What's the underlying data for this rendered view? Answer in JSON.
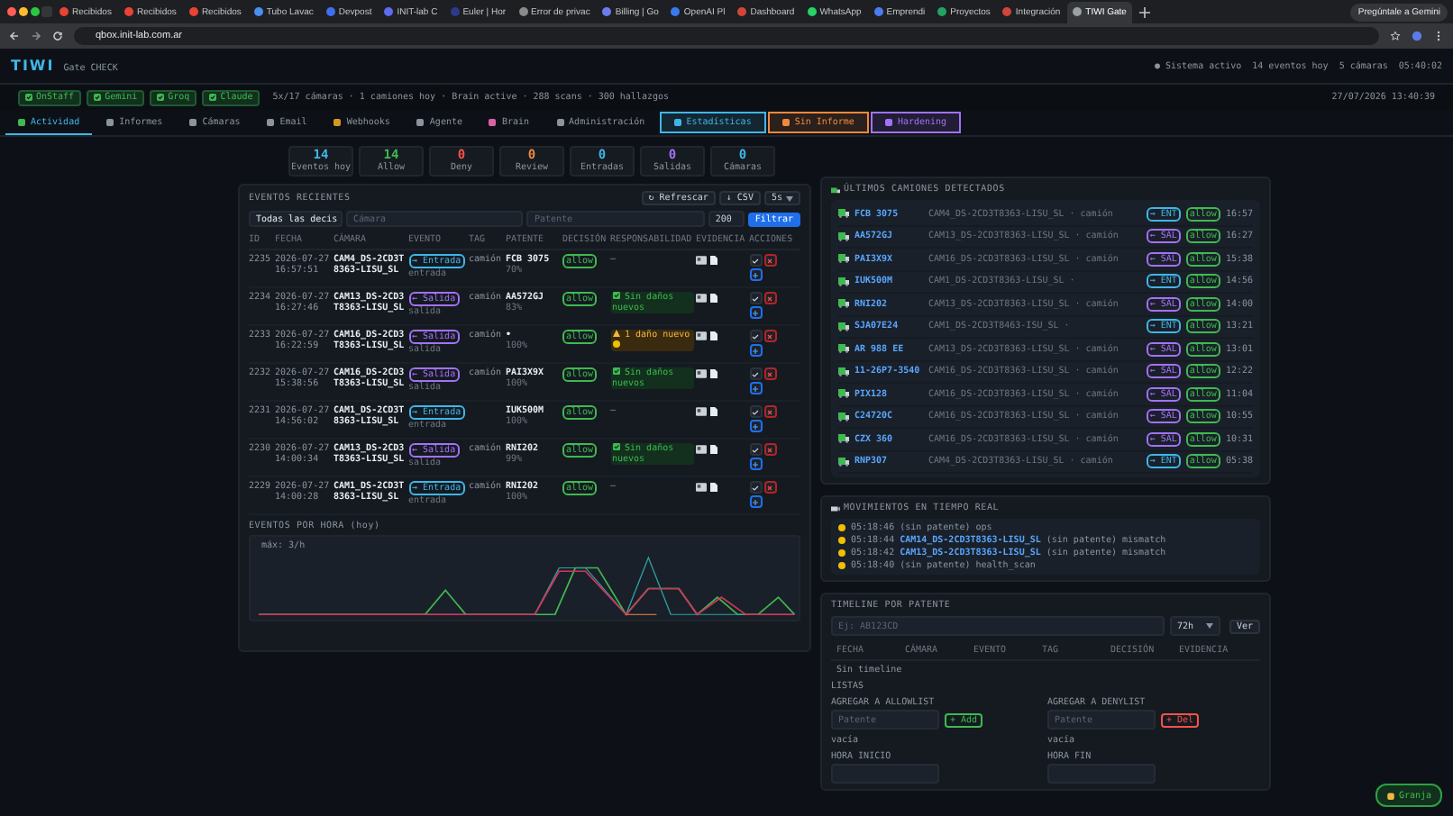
{
  "browser": {
    "tabs": [
      {
        "label": "Recibidos",
        "color": "#ea4335",
        "selected": false
      },
      {
        "label": "Recibidos",
        "color": "#ea4335",
        "selected": false
      },
      {
        "label": "Recibidos",
        "color": "#ea4335",
        "selected": false
      },
      {
        "label": "Tubo Lavac",
        "color": "#4a8ff0",
        "selected": false
      },
      {
        "label": "Devpost",
        "color": "#3d6ff0",
        "selected": false
      },
      {
        "label": "INIT-lab C",
        "color": "#5b6cf0",
        "selected": false
      },
      {
        "label": "Euler | Hor",
        "color": "#2b3a8a",
        "selected": false
      },
      {
        "label": "Error de privac",
        "color": "#8a8a8a",
        "selected": false
      },
      {
        "label": "Billing | Go",
        "color": "#6e7bf0",
        "selected": false
      },
      {
        "label": "OpenAI Pl",
        "color": "#3a7af0",
        "selected": false
      },
      {
        "label": "Dashboard",
        "color": "#d2453b",
        "selected": false
      },
      {
        "label": "WhatsApp",
        "color": "#25d366",
        "selected": false
      },
      {
        "label": "Emprendi",
        "color": "#4a7cf0",
        "selected": false
      },
      {
        "label": "Proyectos",
        "color": "#1fa463",
        "selected": false
      },
      {
        "label": "Integración",
        "color": "#d2453b",
        "selected": false
      },
      {
        "label": "TIWI Gate",
        "color": "#9aa0a6",
        "selected": true
      }
    ],
    "gemini": "Pregúntale a Gemini",
    "url": "qbox.init-lab.com.ar"
  },
  "header": {
    "logo": "TIWI",
    "subtitle": "Gate CHECK",
    "status": [
      "● Sistema activo",
      "14 eventos hoy",
      "5 cámaras",
      "05:40:02"
    ]
  },
  "services": [
    {
      "label": "OnStaff",
      "checked": true
    },
    {
      "label": "Gemini",
      "checked": true
    },
    {
      "label": "Groq",
      "checked": true
    },
    {
      "label": "Claude",
      "checked": true
    }
  ],
  "summary": "5x/17 cámaras · 1 camiones hoy · Brain active · 288 scans · 300 hallazgos",
  "timestamp": "27/07/2026 13:40:39",
  "nav": [
    {
      "label": "Actividad",
      "selected": true,
      "color": "#3fb950"
    },
    {
      "label": "Informes",
      "selected": false,
      "color": "#8b949e"
    },
    {
      "label": "Cámaras",
      "selected": false,
      "color": "#8b949e"
    },
    {
      "label": "Email",
      "selected": false,
      "color": "#8b949e"
    },
    {
      "label": "Webhooks",
      "selected": false,
      "color": "#d29922"
    },
    {
      "label": "Agente",
      "selected": false,
      "color": "#8b949e"
    },
    {
      "label": "Brain",
      "selected": false,
      "color": "#db61a2"
    },
    {
      "label": "Administración",
      "selected": false,
      "color": "#8b949e"
    },
    {
      "label": "Estadísticas",
      "selected": false,
      "kind": "boxed",
      "color": "#3fb6e8"
    },
    {
      "label": "Sin Informe",
      "selected": false,
      "kind": "boxed",
      "color": "#f0883e"
    },
    {
      "label": "Hardening",
      "selected": false,
      "kind": "boxed",
      "color": "#a371f7"
    }
  ],
  "stats": [
    {
      "value": "14",
      "label": "Eventos hoy",
      "color": "#3fb6e8"
    },
    {
      "value": "14",
      "label": "Allow",
      "color": "#3fb950"
    },
    {
      "value": "0",
      "label": "Deny",
      "color": "#f85149"
    },
    {
      "value": "0",
      "label": "Review",
      "color": "#f0883e"
    },
    {
      "value": "0",
      "label": "Entradas",
      "color": "#3fb6e8"
    },
    {
      "value": "0",
      "label": "Salidas",
      "color": "#a371f7"
    },
    {
      "value": "0",
      "label": "Cámaras",
      "color": "#3fb6e8"
    }
  ],
  "events": {
    "title": "EVENTOS RECIENTES",
    "refresh": "↻ Refrescar",
    "csv": "↓ CSV",
    "interval": "5s",
    "filter_decision": "Todas las decis",
    "camera_placeholder": "Cámara",
    "plate_placeholder": "Patente",
    "limit": "200",
    "filter_button": "Filtrar",
    "columns": [
      "ID",
      "FECHA",
      "CÁMARA",
      "EVENTO",
      "TAG",
      "PATENTE",
      "DECISIÓN",
      "RESPONSABILIDAD",
      "EVIDENCIA",
      "ACCIONES"
    ],
    "rows": [
      {
        "id": "2235",
        "date": "2026-07-27 16:57:51",
        "camera": "CAM4_DS-2CD3T8363-LISU_SL",
        "event": {
          "label": "→ Entrada",
          "sub": "entrada",
          "kind": "in"
        },
        "tag": "camión",
        "plate": "FCB 3075",
        "conf": "70%",
        "decision": "allow",
        "resp": {
          "kind": "none",
          "text": "—"
        }
      },
      {
        "id": "2234",
        "date": "2026-07-27 16:27:46",
        "camera": "CAM13_DS-2CD3T8363-LISU_SL",
        "event": {
          "label": "← Salida",
          "sub": "salida",
          "kind": "out"
        },
        "tag": "camión",
        "plate": "AA572GJ",
        "conf": "83%",
        "decision": "allow",
        "resp": {
          "kind": "ok",
          "text": "Sin daños nuevos"
        }
      },
      {
        "id": "2233",
        "date": "2026-07-27 16:22:59",
        "camera": "CAM16_DS-2CD3T8363-LISU_SL",
        "event": {
          "label": "← Salida",
          "sub": "salida",
          "kind": "out"
        },
        "tag": "camión",
        "plate": "•",
        "conf": "100%",
        "decision": "allow",
        "resp": {
          "kind": "warn",
          "text": "1 daño nuevo"
        }
      },
      {
        "id": "2232",
        "date": "2026-07-27 15:38:56",
        "camera": "CAM16_DS-2CD3T8363-LISU_SL",
        "event": {
          "label": "← Salida",
          "sub": "salida",
          "kind": "out"
        },
        "tag": "camión",
        "plate": "PAI3X9X",
        "conf": "100%",
        "decision": "allow",
        "resp": {
          "kind": "ok",
          "text": "Sin daños nuevos"
        }
      },
      {
        "id": "2231",
        "date": "2026-07-27 14:56:02",
        "camera": "CAM1_DS-2CD3T8363-LISU_SL",
        "event": {
          "label": "→ Entrada",
          "sub": "entrada",
          "kind": "in"
        },
        "plate": "IUK500M",
        "conf": "100%",
        "decision": "allow",
        "resp": {
          "kind": "none",
          "text": "—"
        }
      },
      {
        "id": "2230",
        "date": "2026-07-27 14:00:34",
        "camera": "CAM13_DS-2CD3T8363-LISU_SL",
        "event": {
          "label": "← Salida",
          "sub": "salida",
          "kind": "out"
        },
        "tag": "camión",
        "plate": "RNI202",
        "conf": "99%",
        "decision": "allow",
        "resp": {
          "kind": "ok",
          "text": "Sin daños nuevos"
        }
      },
      {
        "id": "2229",
        "date": "2026-07-27 14:00:28",
        "camera": "CAM1_DS-2CD3T8363-LISU_SL",
        "event": {
          "label": "→ Entrada",
          "sub": "entrada",
          "kind": "in"
        },
        "tag": "camión",
        "plate": "RNI202",
        "conf": "100%",
        "decision": "allow",
        "resp": {
          "kind": "none",
          "text": "—"
        }
      }
    ]
  },
  "hourly": {
    "title": "EVENTOS POR HORA (hoy)",
    "max": "máx: 3/h"
  },
  "trucks": {
    "title": "ÚLTIMOS CAMIONES DETECTADOS",
    "rows": [
      {
        "plate": "FCB 3075",
        "camera": "CAM4_DS-2CD3T8363-LISU_SL · camión",
        "dir": "→ ENT",
        "kind": "in",
        "decision": "allow",
        "time": "16:57"
      },
      {
        "plate": "AA572GJ",
        "camera": "CAM13_DS-2CD3T8363-LISU_SL · camión",
        "dir": "← SAL",
        "kind": "out",
        "decision": "allow",
        "time": "16:27"
      },
      {
        "plate": "PAI3X9X",
        "camera": "CAM16_DS-2CD3T8363-LISU_SL · camión",
        "dir": "← SAL",
        "kind": "out",
        "decision": "allow",
        "time": "15:38"
      },
      {
        "plate": "IUK500M",
        "camera": "CAM1_DS-2CD3T8363-LISU_SL ·",
        "dir": "→ ENT",
        "kind": "in",
        "decision": "allow",
        "time": "14:56"
      },
      {
        "plate": "RNI202",
        "camera": "CAM13_DS-2CD3T8363-LISU_SL · camión",
        "dir": "← SAL",
        "kind": "out",
        "decision": "allow",
        "time": "14:00"
      },
      {
        "plate": "SJA07E24",
        "camera": "CAM1_DS-2CD3T8463-ISU_SL ·",
        "dir": "→ ENT",
        "kind": "in",
        "decision": "allow",
        "time": "13:21"
      },
      {
        "plate": "AR 988 EE",
        "camera": "CAM13_DS-2CD3T8363-LISU_SL · camión",
        "dir": "← SAL",
        "kind": "out",
        "decision": "allow",
        "time": "13:01"
      },
      {
        "plate": "11-26P7-3540",
        "camera": "CAM16_DS-2CD3T8363-LISU_SL · camión",
        "dir": "← SAL",
        "kind": "out",
        "decision": "allow",
        "time": "12:22"
      },
      {
        "plate": "PIX128",
        "camera": "CAM16_DS-2CD3T8363-LISU_SL · camión",
        "dir": "← SAL",
        "kind": "out",
        "decision": "allow",
        "time": "11:04"
      },
      {
        "plate": "C24720C",
        "camera": "CAM16_DS-2CD3T8363-LISU_SL · camión",
        "dir": "← SAL",
        "kind": "out",
        "decision": "allow",
        "time": "10:55"
      },
      {
        "plate": "CZX 360",
        "camera": "CAM16_DS-2CD3T8363-LISU_SL · camión",
        "dir": "← SAL",
        "kind": "out",
        "decision": "allow",
        "time": "10:31"
      },
      {
        "plate": "RNP307",
        "camera": "CAM4_DS-2CD3T8363-LISU_SL · camión",
        "dir": "→ ENT",
        "kind": "in",
        "decision": "allow",
        "time": "05:38"
      }
    ]
  },
  "movements": {
    "title": "MOVIMIENTOS EN TIEMPO REAL",
    "items": [
      "05:18:46 (sin patente) ops",
      "05:18:44 **CAM14_DS-2CD3T8363-LISU_SL** (sin patente) mismatch",
      "05:18:42 **CAM13_DS-2CD3T8363-LISU_SL** (sin patente) mismatch",
      "05:18:40 (sin patente) health_scan"
    ]
  },
  "timeline": {
    "title": "TIMELINE POR PATENTE",
    "placeholder": "Ej: AB123CD",
    "range": "72h",
    "button": "Ver",
    "columns": [
      "FECHA",
      "CÁMARA",
      "EVENTO",
      "TAG",
      "DECISIÓN",
      "EVIDENCIA"
    ],
    "empty": "Sin timeline"
  },
  "lists": {
    "title": "LISTAS",
    "groups": [
      {
        "label": "AGREGAR A ALLOWLIST",
        "placeholder": "Patente",
        "button": "+ Add",
        "kind": "allow",
        "empty": "vacía"
      },
      {
        "label": "AGREGAR A DENYLIST",
        "placeholder": "Patente",
        "button": "+ Del",
        "kind": "deny",
        "empty": "vacía"
      }
    ],
    "times": [
      "HORA INICIO",
      "HORA FIN"
    ]
  },
  "fab": "Granja"
}
